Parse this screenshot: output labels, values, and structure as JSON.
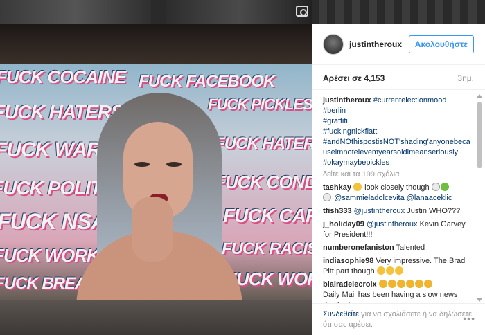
{
  "post": {
    "username": "justintheroux",
    "follow_label": "Ακολουθήστε",
    "likes_text": "Αρέσει σε 4,153",
    "time_ago": "3ημ."
  },
  "caption": {
    "username": "justintheroux",
    "tags": [
      "#currentelectionmood",
      "#berlin",
      "#graffiti",
      "#fuckingnickflatt"
    ],
    "long_tag": "#andNOthispostisNOT'shading'anyonebecauseimnotelevemyearsoldimeanseriously",
    "last_tag": "#okaymaybepickles"
  },
  "view_all": "δείτε και τα 199 σχόλια",
  "comments": [
    {
      "user": "tashkay",
      "text": "look closely though",
      "mentions": "@sammieladolcevita @lanaaceklic"
    },
    {
      "user": "tfish333",
      "mention": "@justintheroux",
      "text": "Justin WHO???"
    },
    {
      "user": "j_holiday09",
      "mention": "@justintheroux",
      "text": "Kevin Garvey for President!!!"
    },
    {
      "user": "numberonefaniston",
      "text": "Talented"
    },
    {
      "user": "indiasophie98",
      "text": "Very impressive. The Brad Pitt part though"
    },
    {
      "user": "blairadelecroix",
      "text": "Daily Mail has been having a slow news day for ten years so..."
    }
  ],
  "footer": {
    "login_link": "Συνδεθείτε",
    "rest": " για να σχολιάσετε ή να δηλώσετε ότι σας αρέσει.",
    "more": "•••"
  },
  "graffiti": [
    "FUCK FACEBOOK",
    "FUCK PICKLES",
    "FUCK COCAINE",
    "FUCK HATERS",
    "FUCK CONDOMS",
    "FUCK NSA",
    "FUCK CAPITAL",
    "FUCK RACISM",
    "FUCK WAR",
    "FUCK WORK",
    "FUCK POLITICS",
    "FUCK BREAD"
  ]
}
